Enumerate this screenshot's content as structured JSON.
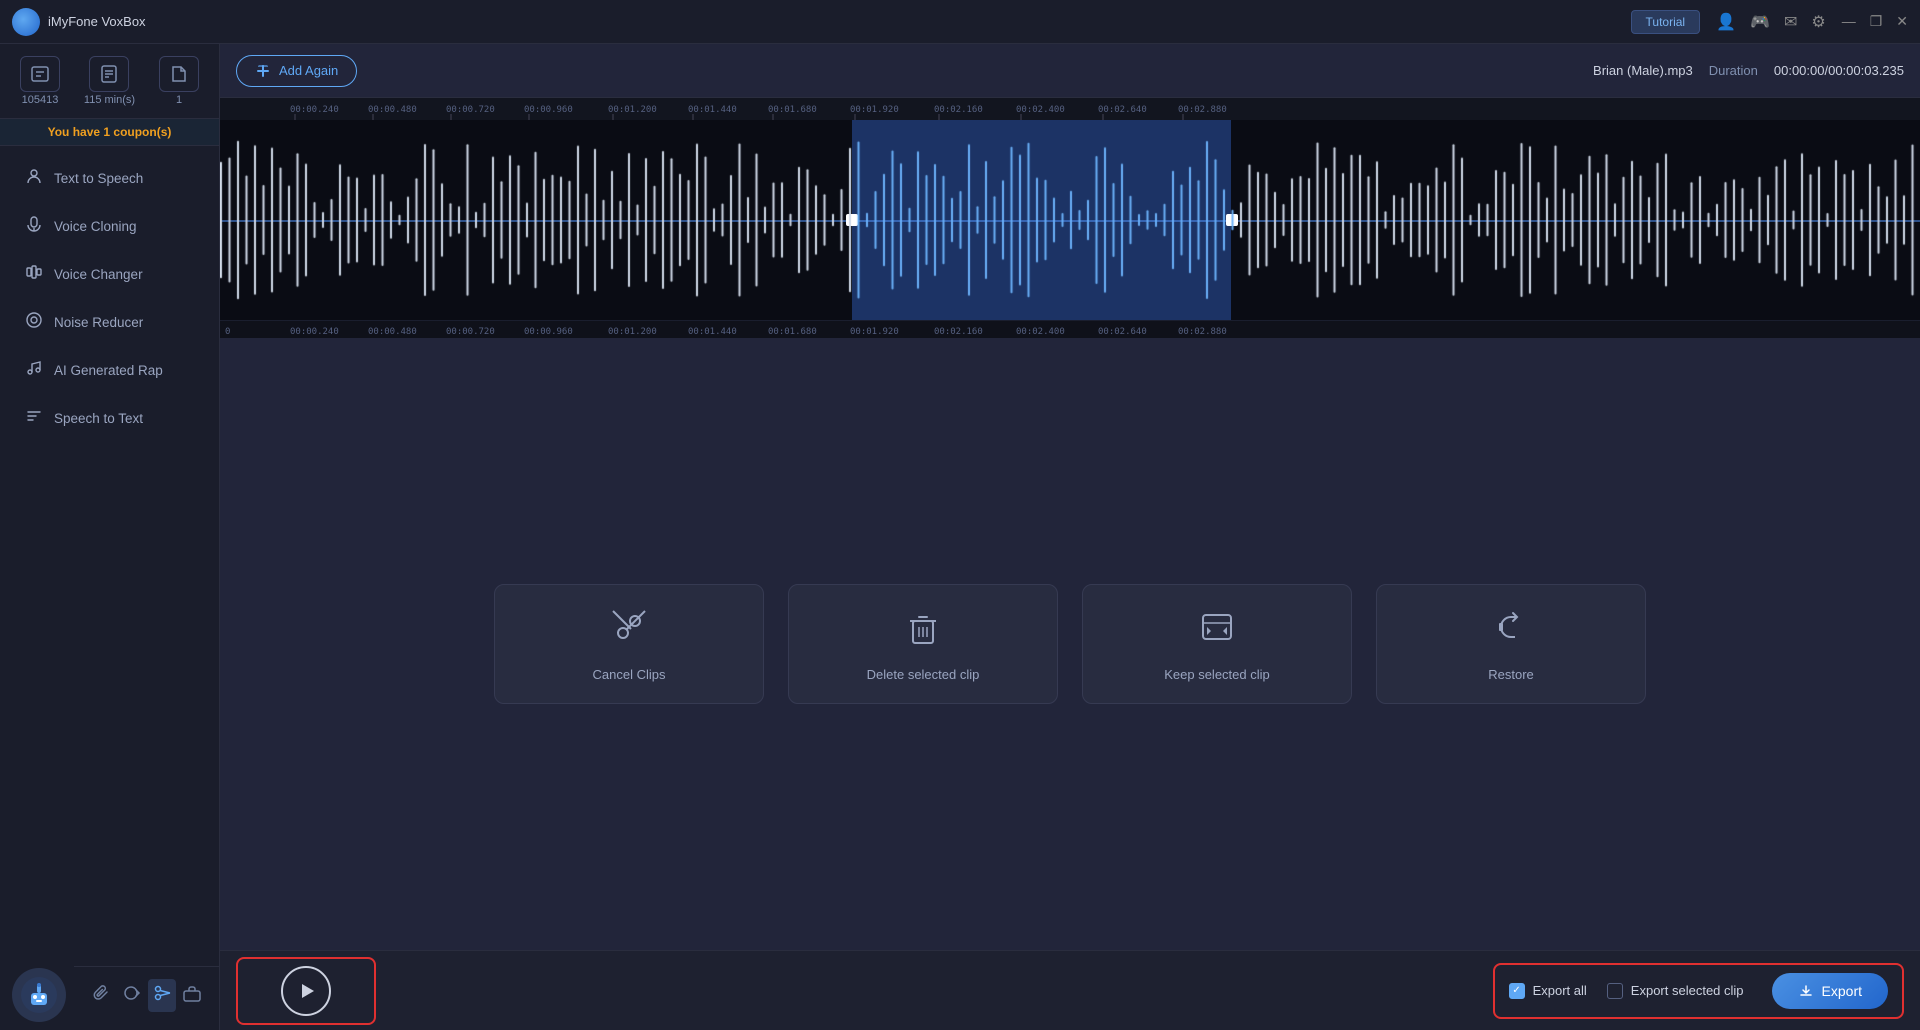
{
  "app": {
    "title": "iMyFone VoxBox",
    "tutorial_label": "Tutorial"
  },
  "titlebar_icons": [
    "👤",
    "🎮",
    "✉",
    "⚙"
  ],
  "window_controls": [
    "—",
    "❐",
    "✕"
  ],
  "stats": [
    {
      "icon": "⏺",
      "value": "105413"
    },
    {
      "icon": "⏱",
      "value": "115 min(s)"
    },
    {
      "icon": "📄",
      "value": "1"
    }
  ],
  "coupon": "You have 1 coupon(s)",
  "nav_items": [
    {
      "label": "Text to Speech",
      "icon": "🗣"
    },
    {
      "label": "Voice Cloning",
      "icon": "🎙"
    },
    {
      "label": "Voice Changer",
      "icon": "🎛"
    },
    {
      "label": "Noise Reducer",
      "icon": "🔇"
    },
    {
      "label": "AI Generated Rap",
      "icon": "🎵"
    },
    {
      "label": "Speech to Text",
      "icon": "📝"
    }
  ],
  "bottom_icons": [
    "📎",
    "↩",
    "✂",
    "💼"
  ],
  "top_bar": {
    "add_again_label": "Add Again",
    "file_name": "Brian (Male).mp3",
    "duration_label": "Duration",
    "duration_value": "00:00:00/00:00:03.235"
  },
  "timeline_marks": [
    "00:00.240",
    "00:00.480",
    "00:00.720",
    "00:00.960",
    "00:01.200",
    "00:01.440",
    "00:01.680",
    "00:01.920",
    "00:02.160",
    "00:02.400",
    "00:02.640",
    "00:02.880",
    ""
  ],
  "action_cards": [
    {
      "label": "Cancel Clips",
      "icon": "✂"
    },
    {
      "label": "Delete selected clip",
      "icon": "🗑"
    },
    {
      "label": "Keep selected clip",
      "icon": "📋"
    },
    {
      "label": "Restore",
      "icon": "↩"
    }
  ],
  "play_button_label": "▶",
  "export": {
    "all_label": "Export all",
    "selected_label": "Export selected clip",
    "btn_label": "Export",
    "all_checked": true,
    "selected_checked": false
  }
}
